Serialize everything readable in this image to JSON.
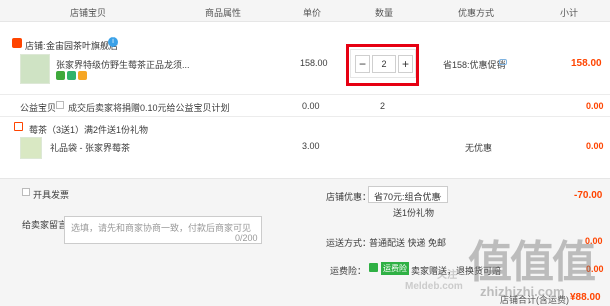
{
  "header": {
    "shop_items": "店铺宝贝",
    "product_attrs": "商品属性",
    "unit_price": "单价",
    "quantity": "数量",
    "discount": "优惠方式",
    "subtotal": "小计"
  },
  "shop": {
    "prefix": "店铺:",
    "name": "金宙园茶叶旗舰店"
  },
  "product": {
    "title": "张家界特级仿野生莓茶正品龙须...",
    "price": "158.00",
    "quantity": "2",
    "minus": "−",
    "plus": "+",
    "promo": "省158:优惠促销",
    "subtotal": "158.00"
  },
  "charity": {
    "label": "公益宝贝",
    "text": "成交后卖家将捐赠0.10元给公益宝贝计划",
    "price": "0.00",
    "quantity": "2",
    "subtotal": "0.00"
  },
  "gift_promo": {
    "name": "莓茶（3送1）",
    "desc": "满2件送1份礼物"
  },
  "gift_item": {
    "title": "礼品袋 - 张家界莓茶",
    "price": "3.00",
    "discount": "无优惠",
    "subtotal": "0.00"
  },
  "invoice": {
    "label": "开具发票"
  },
  "message": {
    "label": "给卖家留言：",
    "placeholder": "选填，请先和商家协商一致，付款后商家可见",
    "counter": "0/200"
  },
  "shop_discount": {
    "label": "店铺优惠：",
    "selected": "省70元:组合优惠",
    "note": "送1份礼物",
    "amount": "-70.00"
  },
  "shipping": {
    "label": "运送方式：",
    "value": "普通配送 快递 免邮",
    "amount": "0.00"
  },
  "insurance": {
    "label": "运费险：",
    "badge": "运费险",
    "text": "卖家赠送，退换货可赔",
    "amount": "0.00"
  },
  "total": {
    "label": "店铺合计(含运费)",
    "amount": "¥88.00"
  },
  "watermark": {
    "big": "值值值",
    "sub": "zhizhizhi.com",
    "meldeb": "Meldeb.com",
    "cn": "关注"
  },
  "colors": {
    "accent": "#ff4400",
    "highlight": "#e60012",
    "green": "#2fb044"
  }
}
